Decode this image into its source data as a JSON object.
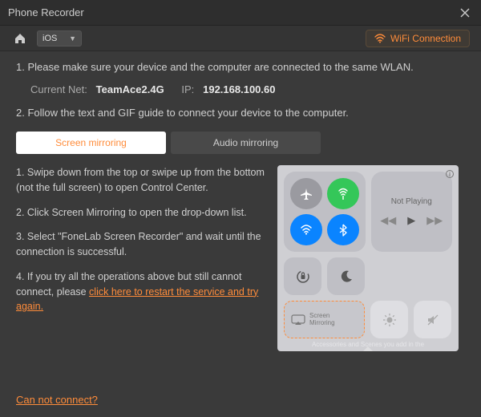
{
  "titlebar": {
    "title": "Phone Recorder"
  },
  "topbar": {
    "os_selected": "iOS",
    "wifi_label": "WiFi Connection"
  },
  "instructions": {
    "step1": "1. Please make sure your device and the computer are connected to the same WLAN.",
    "current_net_label": "Current Net:",
    "current_net_value": "TeamAce2.4G",
    "ip_label": "IP:",
    "ip_value": "192.168.100.60",
    "step2": "2. Follow the text and GIF guide to connect your device to the computer."
  },
  "tabs": {
    "screen": "Screen mirroring",
    "audio": "Audio mirroring"
  },
  "steps": {
    "s1": "1. Swipe down from the top or swipe up from the bottom (not the full screen) to open Control Center.",
    "s2": "2. Click Screen Mirroring to open the drop-down list.",
    "s3": "3. Select \"FoneLab Screen Recorder\" and wait until the connection is successful.",
    "s4_pre": "4. If you try all the operations above but still cannot connect, please ",
    "s4_link": "click here to restart the service and try again."
  },
  "preview": {
    "not_playing": "Not Playing",
    "screen_mirroring_line1": "Screen",
    "screen_mirroring_line2": "Mirroring",
    "footer": "Accessories and Scenes you add in the"
  },
  "footer": {
    "cant_connect": "Can not connect?"
  }
}
